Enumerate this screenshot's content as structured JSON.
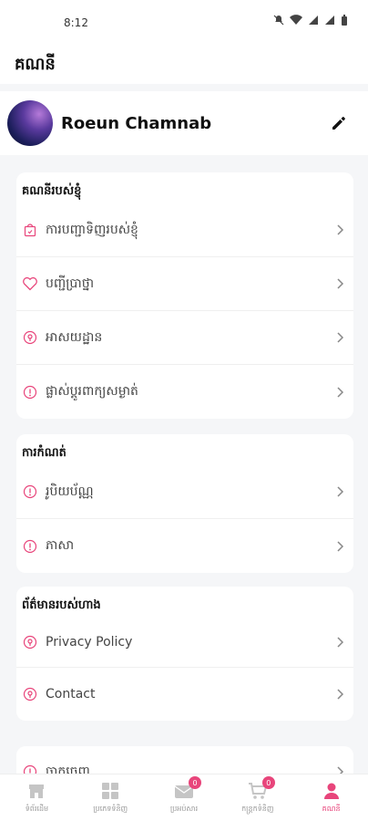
{
  "status": {
    "time": "8:12"
  },
  "header": {
    "title": "គណនី"
  },
  "profile": {
    "name": "Roeun Chamnab"
  },
  "sections": [
    {
      "title": "គណនីរបស់ខ្ញុំ",
      "items": [
        {
          "label": "ការបញ្ជាទិញរបស់ខ្ញុំ",
          "icon": "shopping-bag-icon"
        },
        {
          "label": "បញ្ជីប្រាថ្នា",
          "icon": "heart-icon"
        },
        {
          "label": "អាសយដ្ឋាន",
          "icon": "location-icon"
        },
        {
          "label": "ផ្លាស់ប្តូរពាក្យសម្ងាត់",
          "icon": "info-icon"
        }
      ]
    },
    {
      "title": "ការកំណត់",
      "items": [
        {
          "label": "រូបិយប័ណ្ណ",
          "icon": "info-icon"
        },
        {
          "label": "ភាសា",
          "icon": "info-icon"
        }
      ]
    },
    {
      "title": "ព័ត៌មានរបស់ហាង",
      "items": [
        {
          "label": "Privacy Policy",
          "icon": "location-icon"
        },
        {
          "label": "Contact",
          "icon": "location-icon"
        }
      ]
    },
    {
      "title": "",
      "items": [
        {
          "label": "ចាកចេញ",
          "icon": "info-icon"
        }
      ]
    }
  ],
  "bottom_nav": [
    {
      "label": "ទំព័រដើម",
      "icon": "store-icon",
      "badge": ""
    },
    {
      "label": "ប្រភេទទំនិញ",
      "icon": "grid-icon",
      "badge": ""
    },
    {
      "label": "ប្រអប់សារ",
      "icon": "mail-icon",
      "badge": "0"
    },
    {
      "label": "កន្ត្រកទំនិញ",
      "icon": "cart-icon",
      "badge": "0"
    },
    {
      "label": "គណនី",
      "icon": "user-icon",
      "badge": ""
    }
  ],
  "colors": {
    "accent": "#e8457b",
    "text": "#222222",
    "muted": "#999999"
  }
}
